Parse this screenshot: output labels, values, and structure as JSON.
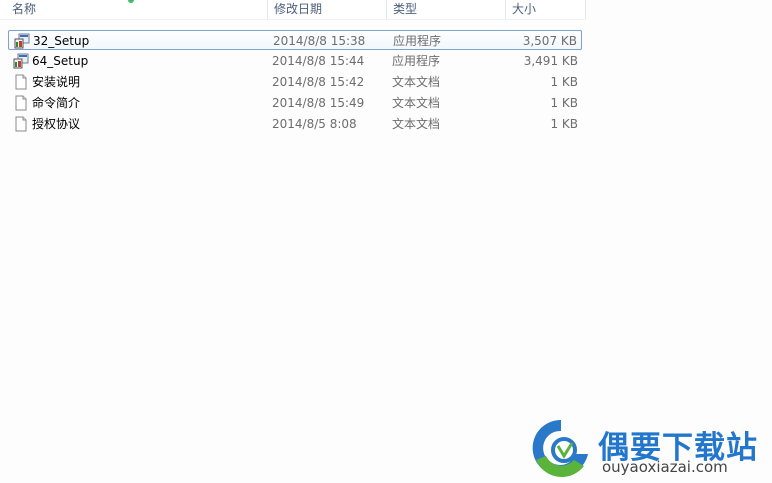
{
  "columns": {
    "name": "名称",
    "date": "修改日期",
    "type": "类型",
    "size": "大小"
  },
  "files": [
    {
      "name": "32_Setup",
      "date": "2014/8/8 15:38",
      "type": "应用程序",
      "size": "3,507 KB",
      "icon": "setup-exe-icon",
      "selected": true
    },
    {
      "name": "64_Setup",
      "date": "2014/8/8 15:44",
      "type": "应用程序",
      "size": "3,491 KB",
      "icon": "setup-exe-icon",
      "selected": false
    },
    {
      "name": "安装说明",
      "date": "2014/8/8 15:42",
      "type": "文本文档",
      "size": "1 KB",
      "icon": "text-document-icon",
      "selected": false
    },
    {
      "name": "命令简介",
      "date": "2014/8/8 15:49",
      "type": "文本文档",
      "size": "1 KB",
      "icon": "text-document-icon",
      "selected": false
    },
    {
      "name": "授权协议",
      "date": "2014/8/5 8:08",
      "type": "文本文档",
      "size": "1 KB",
      "icon": "text-document-icon",
      "selected": false
    }
  ],
  "watermark": {
    "title": "偶要下载站",
    "url": "ouyaoxiazai.com"
  },
  "colors": {
    "selection_border": "#7da2ce",
    "header_text": "#4c607a",
    "watermark_blue": "#2277cc",
    "watermark_green": "#5ab43c"
  }
}
